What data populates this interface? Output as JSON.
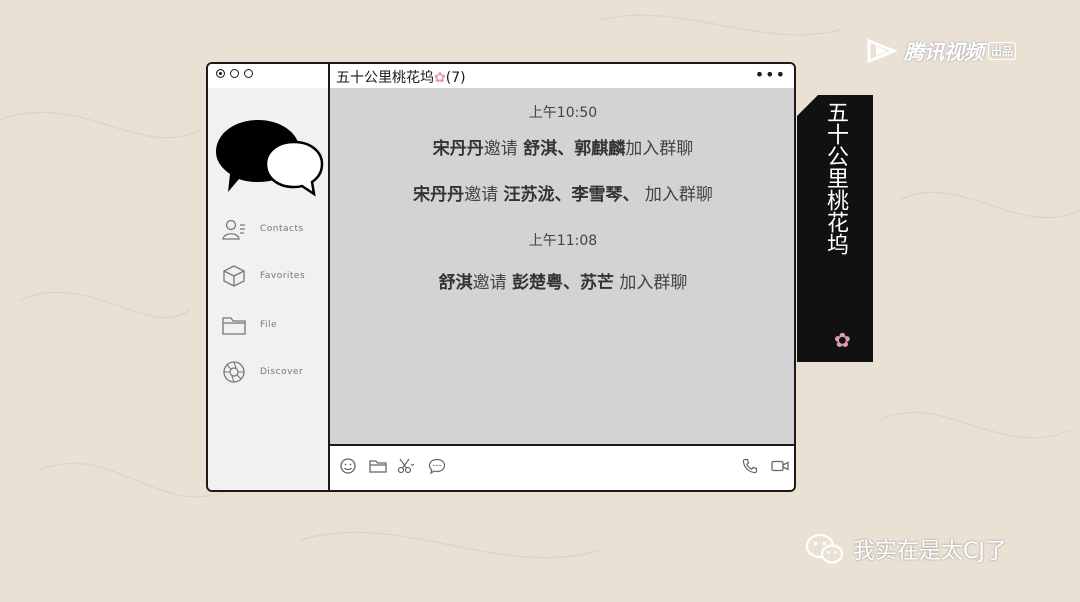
{
  "window": {
    "title": "五十公里桃花坞",
    "title_flower": "✿",
    "member_count": "(7)",
    "more": "•••"
  },
  "sidebar": {
    "items": [
      {
        "label": "Contacts"
      },
      {
        "label": "Favorites"
      },
      {
        "label": "File"
      },
      {
        "label": "Discover"
      }
    ]
  },
  "chat": {
    "time1": "上午10:50",
    "msg1": {
      "inviter": "宋丹丹",
      "verb": "邀请",
      "invitees": "舒淇、郭麒麟",
      "suffix": "加入群聊"
    },
    "msg2": {
      "inviter": "宋丹丹",
      "verb": "邀请",
      "invitees": "汪苏泷、李雪琴、",
      "suffix": "加入群聊"
    },
    "time2": "上午11:08",
    "msg3": {
      "inviter": "舒淇",
      "verb": "邀请",
      "invitees": "彭楚粤、苏芒",
      "suffix": "加入群聊"
    }
  },
  "side_tag": {
    "text": "五十公里桃花坞",
    "flower": "✿"
  },
  "watermarks": {
    "tencent": "腾讯视频",
    "tencent_badge": "出品",
    "wechat_account": "我实在是太CJ了"
  },
  "colors": {
    "background": "#e9e1d4",
    "chat_bg": "#d3d3d3",
    "flower_pink": "#e39bb1",
    "ink": "#1a1a1a"
  }
}
